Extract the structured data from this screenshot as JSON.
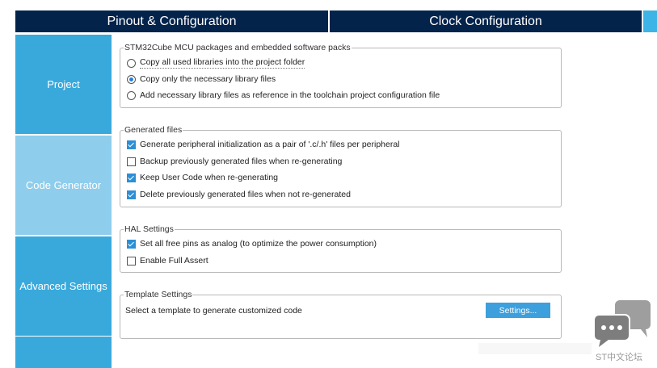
{
  "header": {
    "tabs": [
      {
        "label": "Pinout & Configuration"
      },
      {
        "label": "Clock Configuration"
      }
    ]
  },
  "sidebar": {
    "items": [
      {
        "label": "Project",
        "active": false
      },
      {
        "label": "Code Generator",
        "active": true
      },
      {
        "label": "Advanced Settings",
        "active": false
      },
      {
        "label": "",
        "active": false
      }
    ]
  },
  "packages": {
    "legend": "STM32Cube MCU packages and embedded software packs",
    "options": [
      {
        "label": "Copy all used libraries into the project folder",
        "selected": false
      },
      {
        "label": "Copy only the necessary library files",
        "selected": true
      },
      {
        "label": "Add necessary library files as reference in the toolchain project configuration file",
        "selected": false
      }
    ]
  },
  "generated": {
    "legend": "Generated files",
    "options": [
      {
        "label": "Generate peripheral initialization as a pair of '.c/.h' files per peripheral",
        "checked": true
      },
      {
        "label": "Backup previously generated files when re-generating",
        "checked": false
      },
      {
        "label": "Keep User Code when re-generating",
        "checked": true
      },
      {
        "label": "Delete previously generated files when not re-generated",
        "checked": true
      }
    ]
  },
  "hal": {
    "legend": "HAL Settings",
    "options": [
      {
        "label": "Set all free pins as analog (to optimize the power consumption)",
        "checked": true
      },
      {
        "label": "Enable Full Assert",
        "checked": false
      }
    ]
  },
  "template": {
    "legend": "Template Settings",
    "text": "Select a template to generate customized code",
    "button_label": "Settings..."
  },
  "watermark": {
    "text": "ST中文论坛",
    "icon": "chat-bubbles-icon"
  },
  "colors": {
    "header_bg": "#03234b",
    "sidebar_bg": "#39a9dc",
    "sidebar_active_bg": "#8ecdec",
    "accent": "#3d9fdc"
  }
}
